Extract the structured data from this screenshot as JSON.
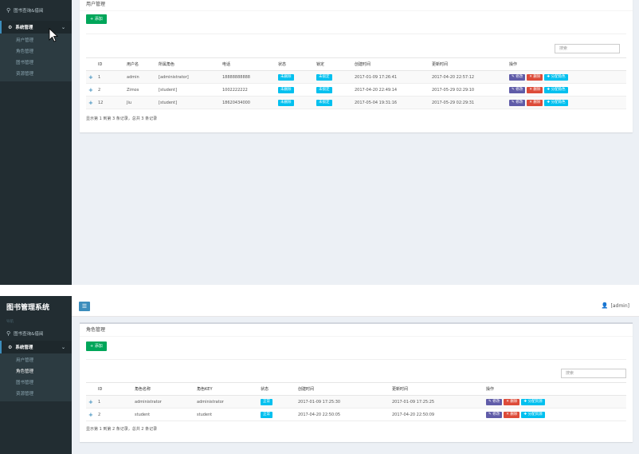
{
  "app": {
    "title": "图书管理系统"
  },
  "sidebar": {
    "nav_label": "导航",
    "search_label": "图书查询&借阅",
    "menu_title": "系统管理",
    "items": [
      {
        "label": "用户管理"
      },
      {
        "label": "角色管理"
      },
      {
        "label": "图书管理"
      },
      {
        "label": "资源管理"
      }
    ]
  },
  "topbar": {
    "user": "[admin]"
  },
  "users": {
    "box_title": "用户管理",
    "add_label": "+ 添加",
    "search_placeholder": "搜索",
    "columns": [
      "ID",
      "用户名",
      "所属角色",
      "电话",
      "状态",
      "锁定",
      "创建时间",
      "更新时间",
      "操作"
    ],
    "rows": [
      {
        "id": "1",
        "name": "admin",
        "role": "[administrator]",
        "phone": "18888888888",
        "status": "未删除",
        "lock": "未锁定",
        "created": "2017-01-09 17:26:41",
        "updated": "2017-04-20 22:57:12"
      },
      {
        "id": "2",
        "name": "Zimos",
        "role": "[student]",
        "phone": "1002222222",
        "status": "未删除",
        "lock": "未锁定",
        "created": "2017-04-20 22:49:14",
        "updated": "2017-05-29 02:29:10"
      },
      {
        "id": "12",
        "name": "Jiu",
        "role": "[student]",
        "phone": "18620434000",
        "status": "未删除",
        "lock": "未锁定",
        "created": "2017-05-04 19:31:16",
        "updated": "2017-05-29 02:29:31"
      }
    ],
    "actions": {
      "edit": "修改",
      "delete": "删除",
      "assign": "分配角色"
    },
    "footer": "显示第 1 到第 3 条记录，总共 3 条记录"
  },
  "roles": {
    "box_title": "角色管理",
    "add_label": "+ 添加",
    "search_placeholder": "搜索",
    "columns": [
      "ID",
      "角色名称",
      "角色KEY",
      "状态",
      "创建时间",
      "更新时间",
      "操作"
    ],
    "rows": [
      {
        "id": "1",
        "name": "administrator",
        "key": "administrator",
        "status": "正常",
        "created": "2017-01-09 17:25:30",
        "updated": "2017-01-09 17:25:25"
      },
      {
        "id": "2",
        "name": "student",
        "key": "student",
        "status": "正常",
        "created": "2017-04-20 22:50:05",
        "updated": "2017-04-20 22:50:09"
      }
    ],
    "actions": {
      "edit": "修改",
      "delete": "删除",
      "assign": "分配资源"
    },
    "footer": "显示第 1 到第 2 条记录，总共 2 条记录"
  },
  "colors": {
    "sidebar": "#222d32",
    "accent": "#3c8dbc",
    "success": "#00a65a",
    "info": "#00c0ef",
    "danger": "#dd4b39",
    "purple": "#605ca8"
  }
}
